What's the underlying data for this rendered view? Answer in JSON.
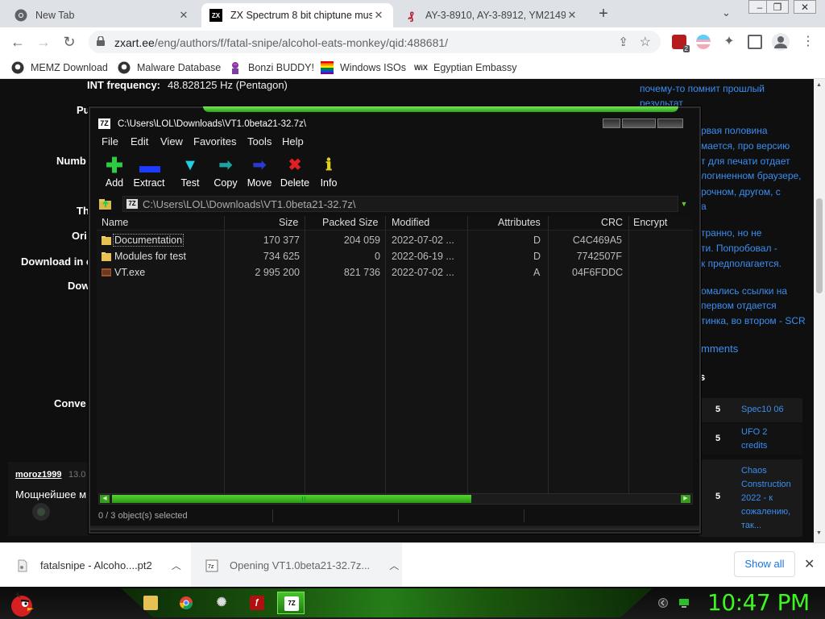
{
  "browser": {
    "tabs": [
      {
        "title": "New Tab",
        "icon": "chrome-icon"
      },
      {
        "title": "ZX Spectrum 8 bit chiptune musi",
        "icon": "zx-icon"
      },
      {
        "title": "AY-3-8910, AY-3-8912, YM2149 (",
        "icon": "ay-icon"
      }
    ],
    "url_host": "zxart.ee",
    "url_path": "/eng/authors/f/fatal-snipe/alcohol-eats-monkey/qid:488681/",
    "extension_badge": "2",
    "bookmarks": [
      {
        "label": "MEMZ Download",
        "icon": "github-icon"
      },
      {
        "label": "Malware Database",
        "icon": "github-icon"
      },
      {
        "label": "Bonzi BUDDY!",
        "icon": "bonzi-icon"
      },
      {
        "label": "Windows ISOs",
        "icon": "rainbow-icon"
      },
      {
        "label": "Egyptian Embassy",
        "icon": "wix-icon"
      }
    ]
  },
  "webpage": {
    "left_labels": [
      "INT frequency:",
      "Pu",
      "Numb",
      "Th",
      "Ori",
      "Download in c",
      "Dow",
      "Conve"
    ],
    "int_frequency_value": "48.828125 Hz (Pentagon)",
    "comment_user": "moroz1999",
    "comment_date": "13.0",
    "comment_text": "Мощнейшее м",
    "right_text": [
      "почему-то помнит прошлый",
      "результат",
      "рвая половина",
      "мается, про версию",
      "т для печати отдает",
      "логиненном браузере,",
      "рочном, другом, с",
      "а",
      "транно, но не",
      "ти. Попробовал -",
      "к предполагается.",
      "омались ссылки на",
      "первом отдается",
      "тинка, во втором - SCR"
    ],
    "comments_link": "mments",
    "rankings": [
      {
        "num": "5",
        "title": "Spec10 06"
      },
      {
        "num": "5",
        "title": "UFO 2 credits"
      },
      {
        "num": "5",
        "title": "Chaos Construction 2022 - к сожалению, так..."
      }
    ]
  },
  "sevenzip": {
    "title": "C:\\Users\\LOL\\Downloads\\VT1.0beta21-32.7z\\",
    "menu": [
      "File",
      "Edit",
      "View",
      "Favorites",
      "Tools",
      "Help"
    ],
    "toolbar": [
      {
        "label": "Add",
        "icon": "add-icon",
        "color": "#2ecc40"
      },
      {
        "label": "Extract",
        "icon": "extract-icon",
        "color": "#1e3cff"
      },
      {
        "label": "Test",
        "icon": "test-icon",
        "color": "#20d0e0"
      },
      {
        "label": "Copy",
        "icon": "copy-icon",
        "color": "#20a0a0"
      },
      {
        "label": "Move",
        "icon": "move-icon",
        "color": "#1a2aaa"
      },
      {
        "label": "Delete",
        "icon": "delete-icon",
        "color": "#e02020"
      },
      {
        "label": "Info",
        "icon": "info-icon",
        "color": "#e0d020"
      }
    ],
    "path": "C:\\Users\\LOL\\Downloads\\VT1.0beta21-32.7z\\",
    "columns": [
      "Name",
      "Size",
      "Packed Size",
      "Modified",
      "Attributes",
      "CRC",
      "Encrypt"
    ],
    "rows": [
      {
        "name": "Documentation",
        "size": "170 377",
        "packed": "204 059",
        "modified": "2022-07-02 ...",
        "attr": "D",
        "crc": "C4C469A5",
        "type": "folder"
      },
      {
        "name": "Modules for test",
        "size": "734 625",
        "packed": "0",
        "modified": "2022-06-19 ...",
        "attr": "D",
        "crc": "7742507F",
        "type": "folder"
      },
      {
        "name": "VT.exe",
        "size": "2 995 200",
        "packed": "821 736",
        "modified": "2022-07-02 ...",
        "attr": "A",
        "crc": "04F6FDDC",
        "type": "exe"
      }
    ],
    "status": "0 / 3 object(s) selected"
  },
  "downloads": {
    "items": [
      {
        "label": "fatalsnipe - Alcoho....pt2"
      },
      {
        "label": "Opening VT1.0beta21-32.7z..."
      }
    ],
    "show_all": "Show all"
  },
  "taskbar": {
    "clock": "10:47 PM",
    "accent": "#3df521"
  }
}
